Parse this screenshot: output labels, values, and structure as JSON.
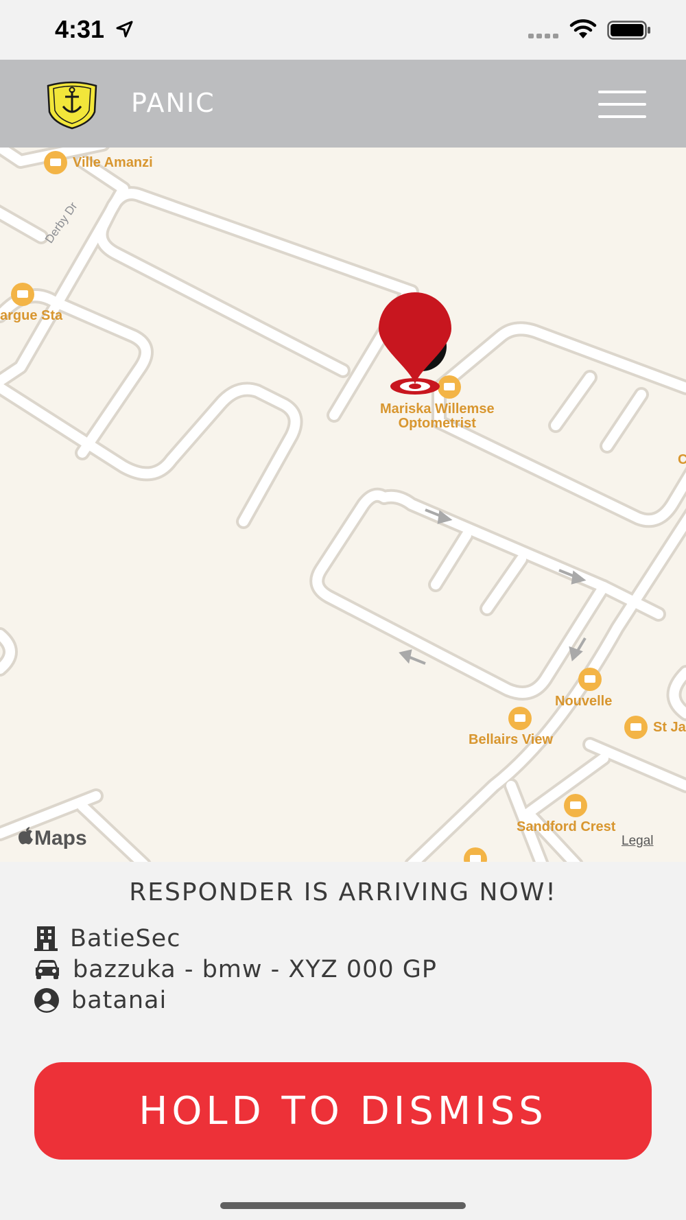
{
  "status_bar": {
    "time": "4:31"
  },
  "header": {
    "title": "PANIC",
    "logo_icon": "security-crest-logo",
    "menu_icon": "hamburger-menu-icon"
  },
  "map": {
    "pois": [
      {
        "label": "Ville Amanzi"
      },
      {
        "label": "argue Sta"
      },
      {
        "label": "Mariska Willemse\nOptometrist"
      },
      {
        "label": "C"
      },
      {
        "label": "Nouvelle"
      },
      {
        "label": "Bellairs View"
      },
      {
        "label": "St Ja"
      },
      {
        "label": "Sandford Crest"
      }
    ],
    "street": "Derby Dr",
    "brand": "Maps",
    "legal": "Legal"
  },
  "responder": {
    "status": "RESPONDER IS ARRIVING NOW!",
    "company": "BatieSec",
    "vehicle": "bazzuka - bmw - XYZ 000 GP",
    "name": "batanai"
  },
  "actions": {
    "dismiss_label": "HOLD TO DISMISS"
  },
  "colors": {
    "header_bg": "#bcbdbf",
    "accent_red": "#ed3138",
    "marker_red": "#c8161f",
    "poi_orange": "#d8962f"
  }
}
